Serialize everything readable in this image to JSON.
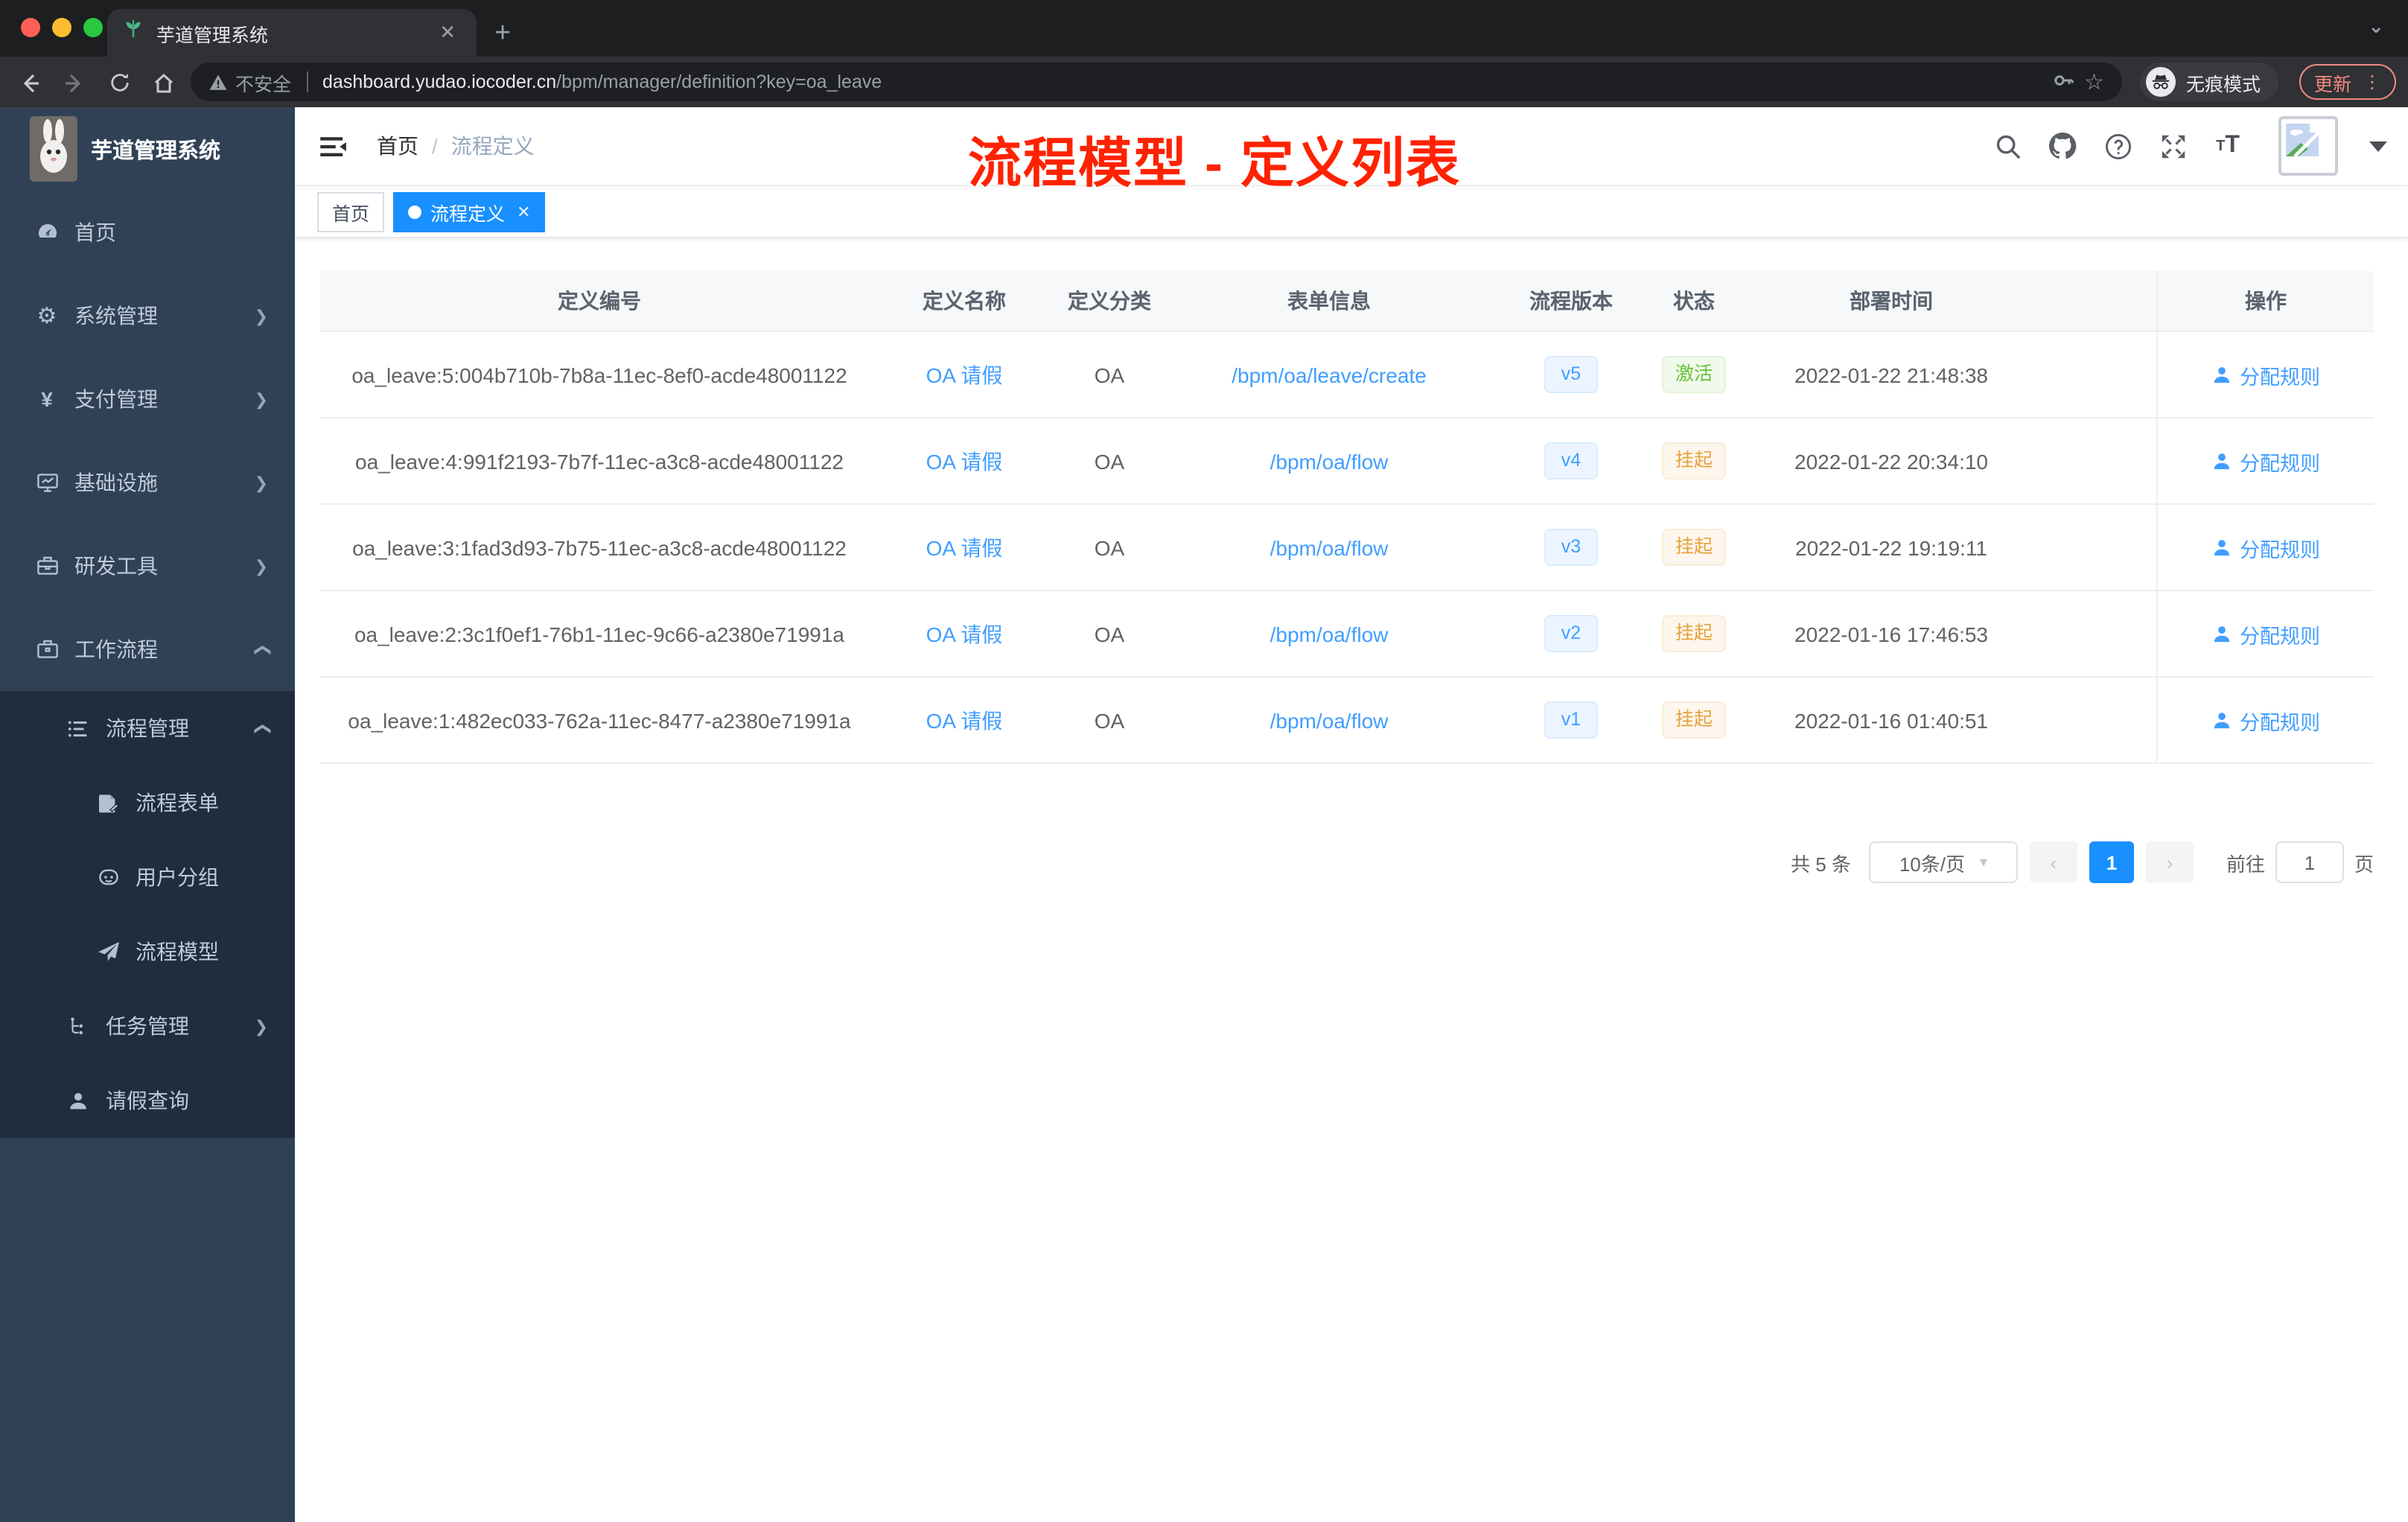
{
  "colors": {
    "primary": "#1890ff",
    "link": "#409eff",
    "annotation": "#ff2200",
    "success_text": "#67c23a",
    "warning_text": "#e6a23c",
    "sidebar_bg": "#304156",
    "submenu_bg": "#1f2d3d"
  },
  "browser": {
    "tab_title": "芋道管理系统",
    "favicon": "sprout-icon",
    "security_label": "不安全",
    "url_domain": "dashboard.yudao.iocoder.cn",
    "url_path": "/bpm/manager/definition?key=oa_leave",
    "incognito_label": "无痕模式",
    "update_label": "更新"
  },
  "sidebar": {
    "logo_title": "芋道管理系统",
    "items": [
      {
        "label": "首页",
        "icon": "dashboard-icon"
      },
      {
        "label": "系统管理",
        "icon": "gear-icon",
        "chevron": "down"
      },
      {
        "label": "支付管理",
        "icon": "yen-icon",
        "chevron": "down"
      },
      {
        "label": "基础设施",
        "icon": "monitor-icon",
        "chevron": "down"
      },
      {
        "label": "研发工具",
        "icon": "toolbox-icon",
        "chevron": "down"
      },
      {
        "label": "工作流程",
        "icon": "briefcase-icon",
        "chevron": "up"
      }
    ],
    "sub": [
      {
        "label": "流程管理",
        "icon": "list-icon",
        "chevron": "up",
        "level": 2
      },
      {
        "label": "流程表单",
        "icon": "form-icon",
        "level": 3
      },
      {
        "label": "用户分组",
        "icon": "robot-icon",
        "level": 3
      },
      {
        "label": "流程模型",
        "icon": "paper-plane-icon",
        "level": 3
      },
      {
        "label": "任务管理",
        "icon": "tree-icon",
        "chevron": "down",
        "level": 2
      },
      {
        "label": "请假查询",
        "icon": "person-icon",
        "level": 2
      }
    ]
  },
  "header": {
    "breadcrumb": {
      "home": "首页",
      "separator": "/",
      "current": "流程定义"
    },
    "annotation": "流程模型 - 定义列表"
  },
  "tags": {
    "home": "首页",
    "active": "流程定义"
  },
  "table": {
    "headers": [
      "定义编号",
      "定义名称",
      "定义分类",
      "表单信息",
      "流程版本",
      "状态",
      "部署时间",
      "操作"
    ],
    "action_label": "分配规则",
    "rows": [
      {
        "id": "oa_leave:5:004b710b-7b8a-11ec-8ef0-acde48001122",
        "name": "OA 请假",
        "category": "OA",
        "form": "/bpm/oa/leave/create",
        "version": "v5",
        "status": "激活",
        "status_type": "success",
        "deployed": "2022-01-22 21:48:38"
      },
      {
        "id": "oa_leave:4:991f2193-7b7f-11ec-a3c8-acde48001122",
        "name": "OA 请假",
        "category": "OA",
        "form": "/bpm/oa/flow",
        "version": "v4",
        "status": "挂起",
        "status_type": "warning",
        "deployed": "2022-01-22 20:34:10"
      },
      {
        "id": "oa_leave:3:1fad3d93-7b75-11ec-a3c8-acde48001122",
        "name": "OA 请假",
        "category": "OA",
        "form": "/bpm/oa/flow",
        "version": "v3",
        "status": "挂起",
        "status_type": "warning",
        "deployed": "2022-01-22 19:19:11"
      },
      {
        "id": "oa_leave:2:3c1f0ef1-76b1-11ec-9c66-a2380e71991a",
        "name": "OA 请假",
        "category": "OA",
        "form": "/bpm/oa/flow",
        "version": "v2",
        "status": "挂起",
        "status_type": "warning",
        "deployed": "2022-01-16 17:46:53"
      },
      {
        "id": "oa_leave:1:482ec033-762a-11ec-8477-a2380e71991a",
        "name": "OA 请假",
        "category": "OA",
        "form": "/bpm/oa/flow",
        "version": "v1",
        "status": "挂起",
        "status_type": "warning",
        "deployed": "2022-01-16 01:40:51"
      }
    ]
  },
  "pagination": {
    "total": "共 5 条",
    "page_size": "10条/页",
    "prev": "‹",
    "current": "1",
    "next": "›",
    "goto_label": "前往",
    "goto_value": "1",
    "page_label": "页"
  }
}
